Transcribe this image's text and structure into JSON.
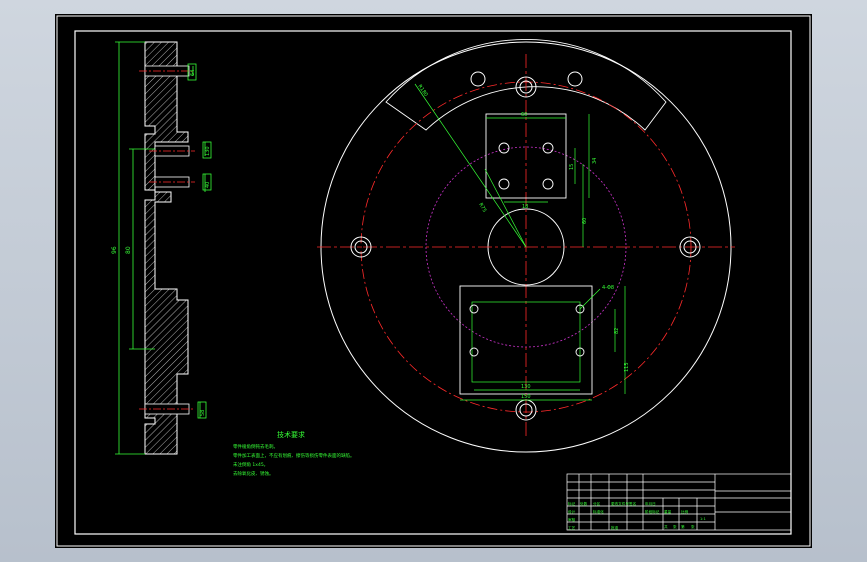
{
  "drawing": {
    "technical_requirements_title": "技术要求",
    "technical_requirements": [
      "零件棱角倒钝去毛刺。",
      "零件加工表面上，不应有划痕、擦伤等损伤零件表面的缺陷。",
      "未注倒角 1x45。",
      "去除氧化皮、锈蚀。"
    ],
    "dims_front": {
      "d1": "96",
      "d2": "80",
      "d3": "64",
      "d4": "130",
      "d5": "40",
      "d6": "58"
    },
    "dims_plan": {
      "a": "60",
      "b": "10",
      "c": "18",
      "d": "10",
      "e": "15",
      "f": "34",
      "g": "60",
      "h": "82",
      "i": "90",
      "j": "150",
      "k": "130",
      "l": "4-Φ8",
      "m": "115",
      "n": "22",
      "r1": "R180",
      "r2": "R75"
    },
    "title_block": {
      "labels": [
        "标记",
        "处数",
        "分区",
        "更改文件号",
        "签名",
        "年月日",
        "设计",
        "标准化",
        "阶段标记",
        "重量",
        "比例",
        "共",
        "张",
        "第",
        "张",
        "审核",
        "工艺",
        "批准"
      ],
      "scale": "1:1"
    }
  },
  "colors": {
    "background": "#000000",
    "outline": "#ffffff",
    "dimension": "#36ff36",
    "centerline": "#ff2a2a",
    "hidden_circle": "#cc33cc",
    "frame_bg": "#c6ced8"
  }
}
